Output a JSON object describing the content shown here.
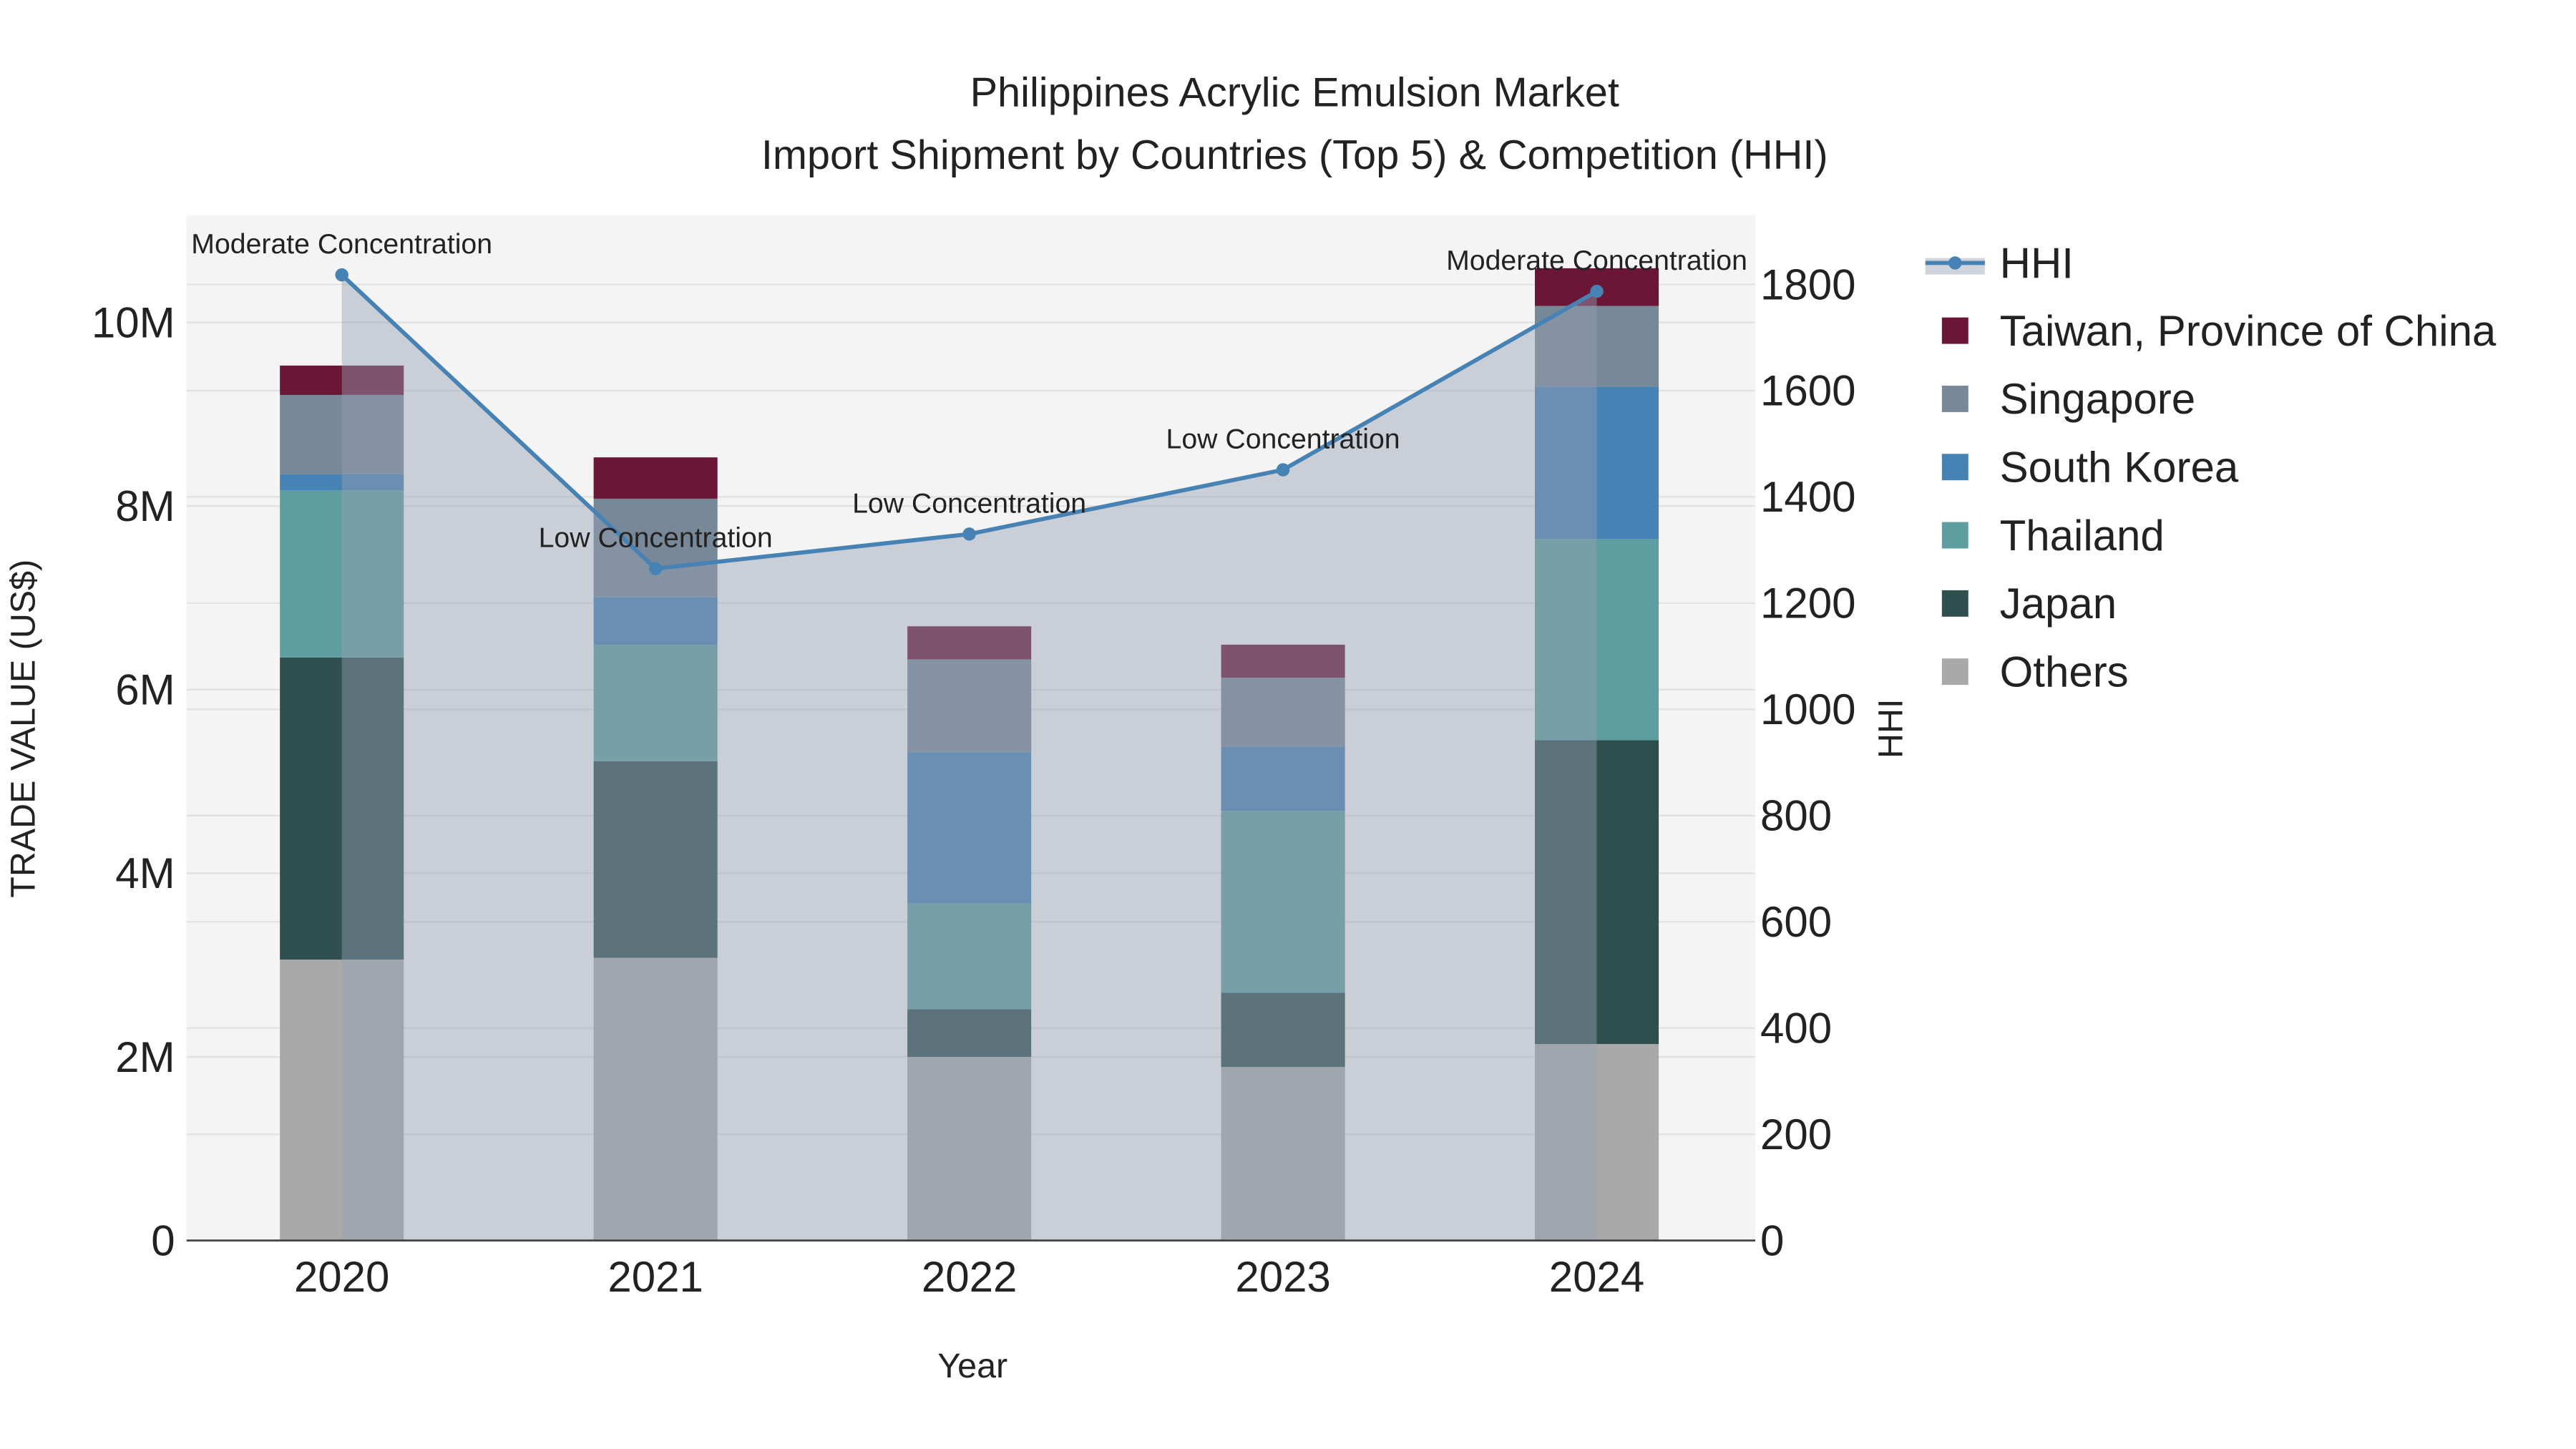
{
  "chart_data": {
    "type": "bar",
    "stacked": true,
    "title": "Philippines Acrylic Emulsion Market",
    "subtitle": "Import Shipment by Countries (Top 5) & Competition (HHI)",
    "xlabel": "Year",
    "ylabel": "TRADE VALUE (US$)",
    "y2label": "HHI",
    "categories": [
      "2020",
      "2021",
      "2022",
      "2023",
      "2024"
    ],
    "ylim": [
      0,
      11100000
    ],
    "y_ticks": [
      0,
      2000000,
      4000000,
      6000000,
      8000000,
      10000000
    ],
    "y_tick_labels": [
      "0",
      "2M",
      "4M",
      "6M",
      "8M",
      "10M"
    ],
    "y2lim": [
      0,
      1930
    ],
    "y2_ticks": [
      0,
      200,
      400,
      600,
      800,
      1000,
      1200,
      1400,
      1600,
      1800
    ],
    "y2_tick_labels": [
      "0",
      "200",
      "400",
      "600",
      "800",
      "1000",
      "1200",
      "1400",
      "1600",
      "1800"
    ],
    "series": [
      {
        "name": "Others",
        "color": "#a9a9a9",
        "values": [
          3060000,
          3080000,
          2000000,
          1890000,
          2140000
        ]
      },
      {
        "name": "Japan",
        "color": "#2f4f4f",
        "values": [
          3290000,
          2140000,
          520000,
          810000,
          3310000
        ]
      },
      {
        "name": "Thailand",
        "color": "#5f9ea0",
        "values": [
          1820000,
          1270000,
          1150000,
          1980000,
          2190000
        ]
      },
      {
        "name": "South Korea",
        "color": "#4682b4",
        "values": [
          180000,
          520000,
          1650000,
          700000,
          1660000
        ]
      },
      {
        "name": "Singapore",
        "color": "#778899",
        "values": [
          860000,
          1070000,
          1010000,
          750000,
          880000
        ]
      },
      {
        "name": "Taiwan, Province of China",
        "color": "#6b1537",
        "values": [
          320000,
          450000,
          360000,
          360000,
          410000
        ]
      }
    ],
    "line": {
      "name": "HHI",
      "color": "#4682b4",
      "values": [
        1818,
        1265,
        1330,
        1451,
        1787
      ],
      "annotations": [
        "Moderate Concentration",
        "Low Concentration",
        "Low Concentration",
        "Low Concentration",
        "Moderate Concentration"
      ]
    },
    "legend": {
      "placement": "right",
      "entries": [
        "HHI",
        "Taiwan, Province of China",
        "Singapore",
        "South Korea",
        "Thailand",
        "Japan",
        "Others"
      ]
    },
    "grid": true
  }
}
